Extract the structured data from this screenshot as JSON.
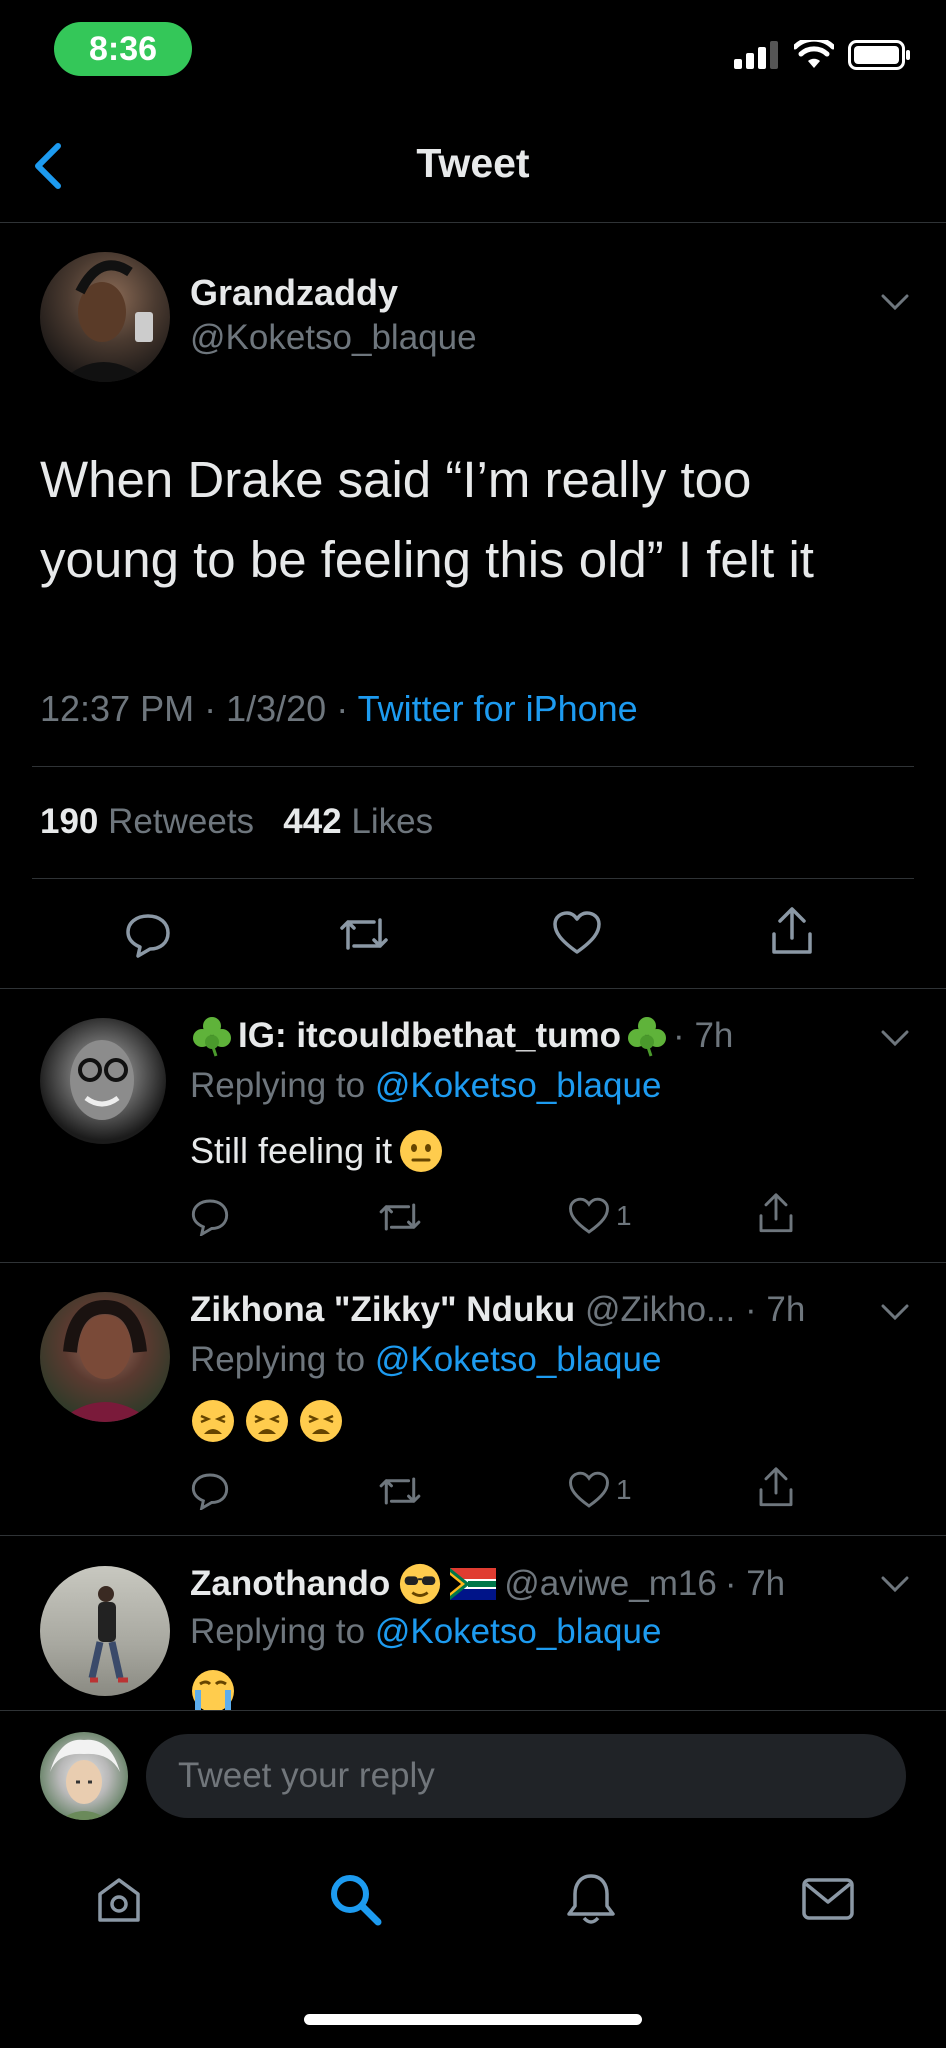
{
  "status_bar": {
    "time": "8:36"
  },
  "header": {
    "title": "Tweet"
  },
  "tweet": {
    "name": "Grandzaddy",
    "handle": "@Koketso_blaque",
    "text": "When Drake said “I’m really too young to be feeling this old” I felt it",
    "time": "12:37 PM",
    "date": "1/3/20",
    "source": "Twitter for iPhone",
    "retweets_count": "190",
    "retweets_label": "Retweets",
    "likes_count": "442",
    "likes_label": "Likes"
  },
  "replies": [
    {
      "name": "IG: itcouldbethat_tumo",
      "name_emoji": "shamrock-icon",
      "handle": "",
      "time": "7h",
      "replying_label": "Replying to",
      "replying_to": "@Koketso_blaque",
      "text": "Still feeling it",
      "text_emoji": [
        "neutral-face-icon"
      ],
      "likes": "1"
    },
    {
      "name": "Zikhona \"Zikky\" Nduku",
      "handle": "@Zikho...",
      "time": "7h",
      "replying_label": "Replying to",
      "replying_to": "@Koketso_blaque",
      "text": "",
      "text_emoji": [
        "weary-face-icon",
        "weary-face-icon",
        "weary-face-icon"
      ],
      "likes": "1"
    },
    {
      "name": "Zanothando",
      "name_emoji": [
        "sunglasses-face-icon",
        "south-africa-flag-icon"
      ],
      "handle": "@aviwe_m16",
      "time": "7h",
      "replying_label": "Replying to",
      "replying_to": "@Koketso_blaque",
      "text_emoji": [
        "crying-face-icon"
      ]
    }
  ],
  "compose": {
    "placeholder": "Tweet your reply"
  },
  "tabs": [
    "home-icon",
    "search-icon",
    "notifications-icon",
    "messages-icon"
  ],
  "colors": {
    "accent": "#1d9bf0",
    "background": "#000000",
    "muted": "#6e767d",
    "divider": "#2f3336"
  }
}
